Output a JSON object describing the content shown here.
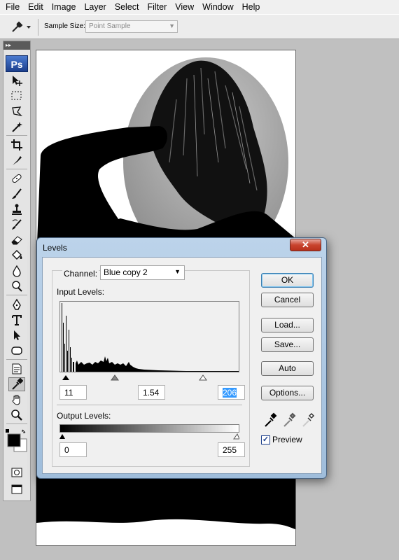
{
  "menu": [
    "File",
    "Edit",
    "Image",
    "Layer",
    "Select",
    "Filter",
    "View",
    "Window",
    "Help"
  ],
  "options": {
    "sample_size_label": "Sample Size:",
    "sample_size_value": "Point Sample"
  },
  "toolbox": {
    "logo": "Ps",
    "tools": [
      "move-tool-icon",
      "marquee-tool-icon",
      "lasso-tool-icon",
      "magic-wand-icon",
      "crop-tool-icon",
      "slice-tool-icon",
      "healing-brush-icon",
      "brush-tool-icon",
      "clone-stamp-icon",
      "history-brush-icon",
      "eraser-tool-icon",
      "paint-bucket-icon",
      "blur-tool-icon",
      "dodge-tool-icon",
      "pen-tool-icon",
      "type-tool-icon",
      "path-select-icon",
      "shape-tool-icon",
      "notes-tool-icon",
      "eyedropper-icon",
      "hand-tool-icon",
      "zoom-tool-icon"
    ]
  },
  "dialog": {
    "title": "Levels",
    "close": "✕",
    "channel_label": "Channel:",
    "channel_value": "Blue copy 2",
    "input_levels_label": "Input Levels:",
    "input_black": "11",
    "input_gamma": "1.54",
    "input_white": "206",
    "output_levels_label": "Output Levels:",
    "output_black": "0",
    "output_white": "255",
    "buttons": {
      "ok": "OK",
      "cancel": "Cancel",
      "load": "Load...",
      "save": "Save...",
      "auto": "Auto",
      "options": "Options..."
    },
    "preview_label": "Preview",
    "preview_checked": true
  },
  "colors": {
    "accent": "#3399ff",
    "dialog_frame": "#a9c4e0",
    "close_button": "#c8432e"
  }
}
